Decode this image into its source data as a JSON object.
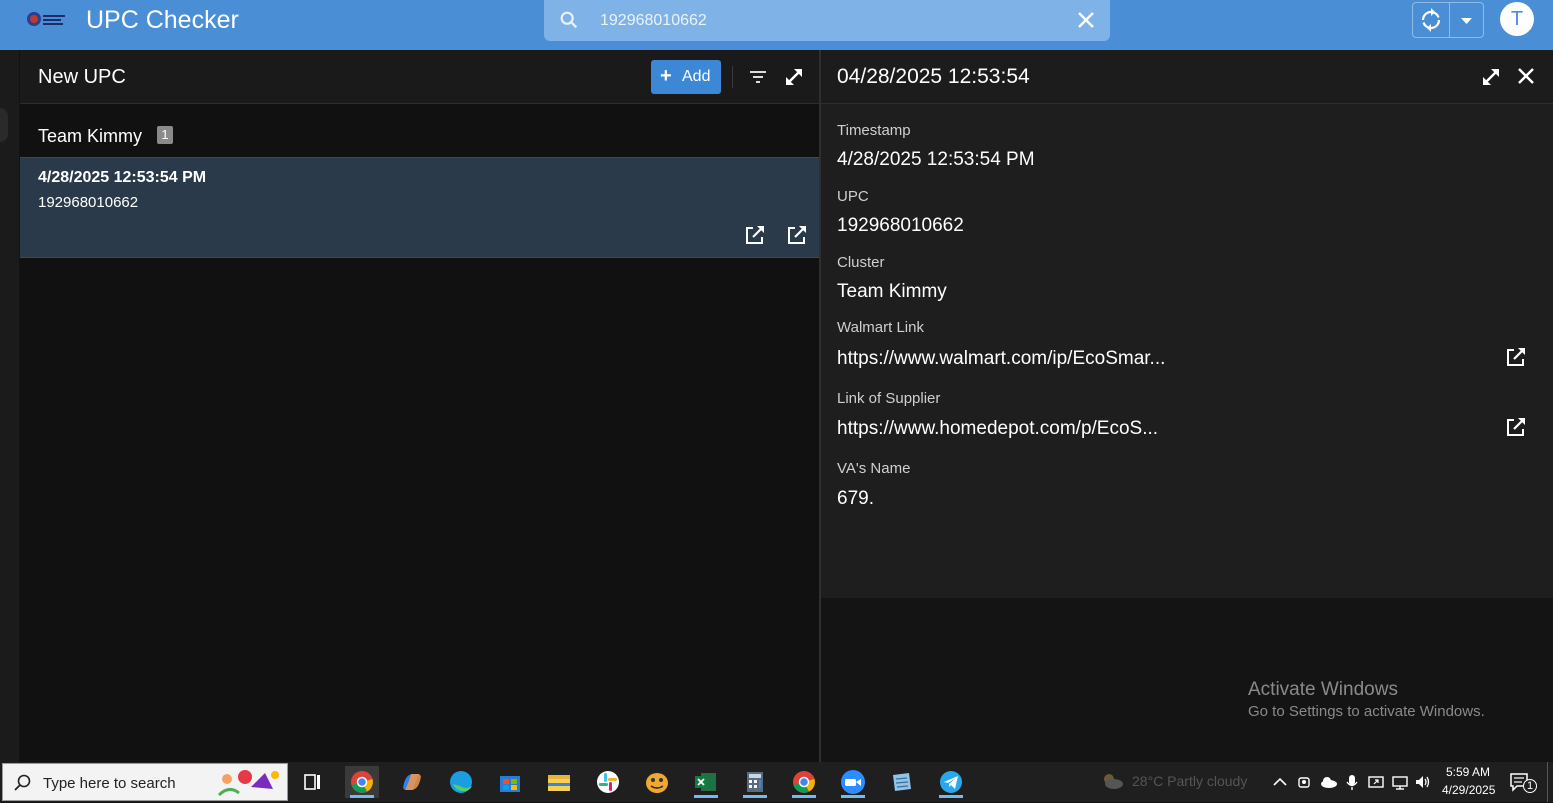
{
  "app": {
    "title": "UPC Checker",
    "search_value": "192968010662",
    "avatar_initial": "T",
    "accent_color": "#4a8fd6"
  },
  "list": {
    "title": "New UPC",
    "add_label": "Add",
    "group": {
      "label": "Team Kimmy",
      "count": "1"
    },
    "items": [
      {
        "timestamp": "4/28/2025 12:53:54 PM",
        "upc": "192968010662"
      }
    ]
  },
  "detail": {
    "title": "04/28/2025 12:53:54",
    "fields": [
      {
        "label": "Timestamp",
        "value": "4/28/2025 12:53:54 PM"
      },
      {
        "label": "UPC",
        "value": "192968010662"
      },
      {
        "label": "Cluster",
        "value": "Team Kimmy"
      },
      {
        "label": "Walmart Link",
        "value": "https://www.walmart.com/ip/EcoSmar..."
      },
      {
        "label": "Link of Supplier",
        "value": "https://www.homedepot.com/p/EcoS..."
      },
      {
        "label": "VA's Name",
        "value": "679."
      }
    ]
  },
  "watermark": {
    "line1": "Activate Windows",
    "line2": "Go to Settings to activate Windows."
  },
  "taskbar": {
    "search_placeholder": "Type here to search",
    "apps": [
      "chrome-icon",
      "copilot-icon",
      "edge-icon",
      "store-icon",
      "file-explorer-icon",
      "slack-icon",
      "game-icon",
      "excel-icon",
      "calculator-icon",
      "chrome-profile-icon",
      "zoom-icon",
      "notepad-icon",
      "telegram-icon"
    ],
    "weather": "28°C  Partly cloudy",
    "time": "5:59 AM",
    "date": "4/29/2025",
    "notification_count": "1"
  }
}
